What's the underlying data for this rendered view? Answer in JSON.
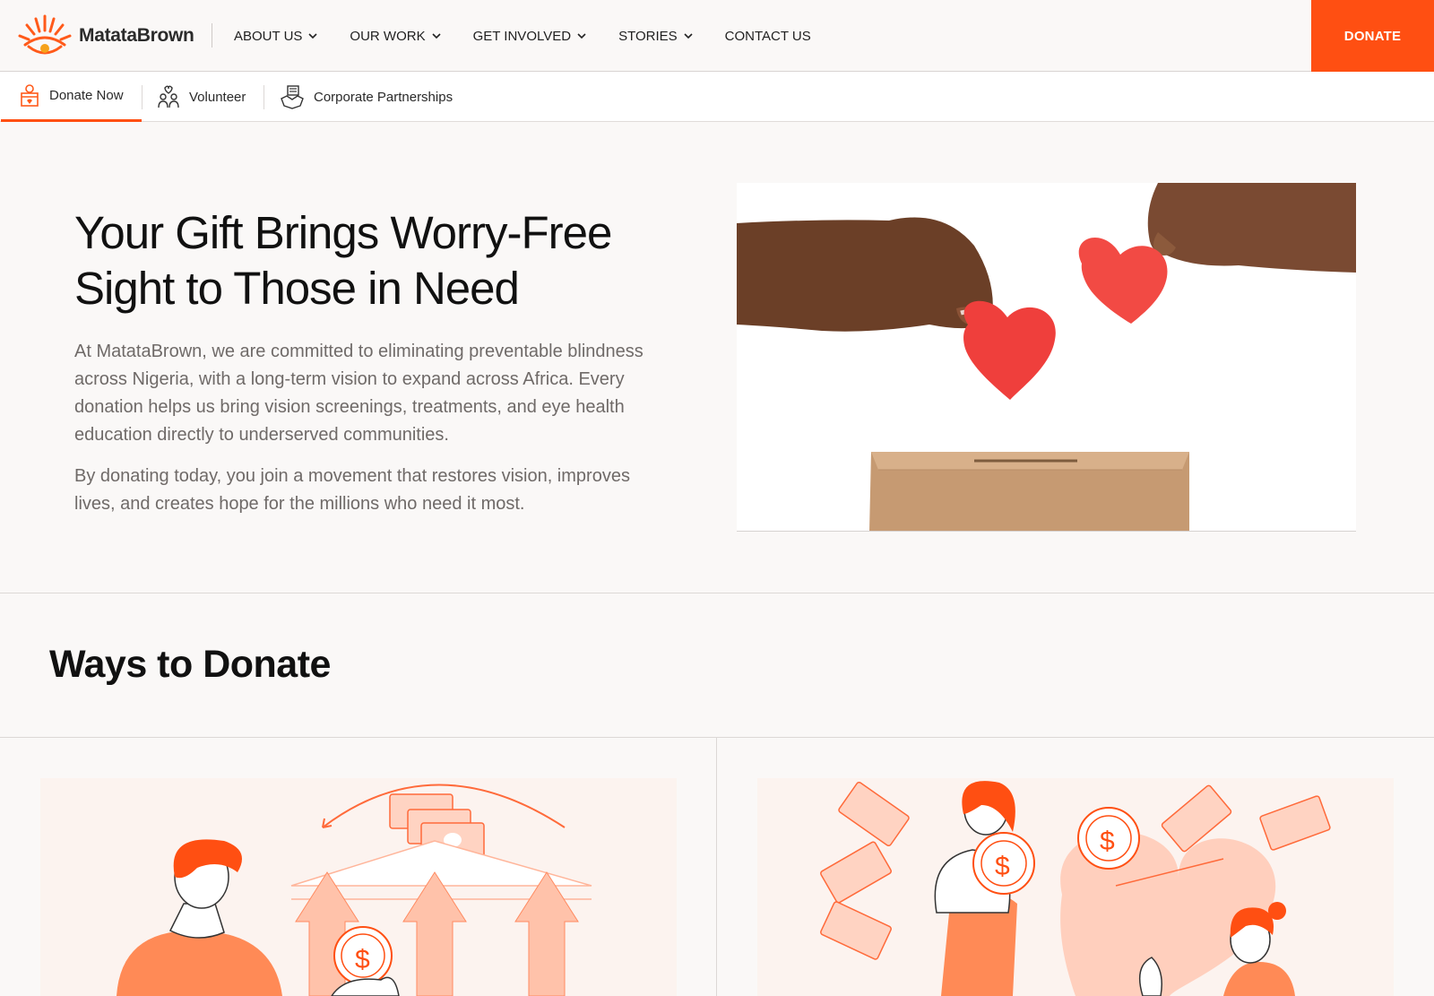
{
  "brand": {
    "name": "MatataBrown",
    "accent": "#ff4f12"
  },
  "nav": {
    "items": [
      {
        "label": "ABOUT US",
        "has_dropdown": true
      },
      {
        "label": "OUR WORK",
        "has_dropdown": true
      },
      {
        "label": "GET INVOLVED",
        "has_dropdown": true
      },
      {
        "label": "STORIES",
        "has_dropdown": true
      },
      {
        "label": "CONTACT US",
        "has_dropdown": false
      }
    ],
    "donate_label": "DONATE"
  },
  "subnav": {
    "tabs": [
      {
        "label": "Donate Now",
        "icon": "donation-box-icon",
        "active": true
      },
      {
        "label": "Volunteer",
        "icon": "volunteer-icon",
        "active": false
      },
      {
        "label": "Corporate Partnerships",
        "icon": "handshake-icon",
        "active": false
      }
    ]
  },
  "hero": {
    "title_line1": "Your Gift Brings Worry-Free",
    "title_line2": "Sight to Those in Need",
    "paragraph1": "At MatataBrown, we are committed to eliminating preventable blindness across Nigeria, with a long-term vision to expand across Africa. Every donation helps us bring vision screenings, treatments, and eye health education directly to underserved communities.",
    "paragraph2": "By donating today, you join a movement that restores vision, improves lives, and creates hope for the millions who need it most."
  },
  "ways": {
    "title": "Ways to Donate"
  }
}
